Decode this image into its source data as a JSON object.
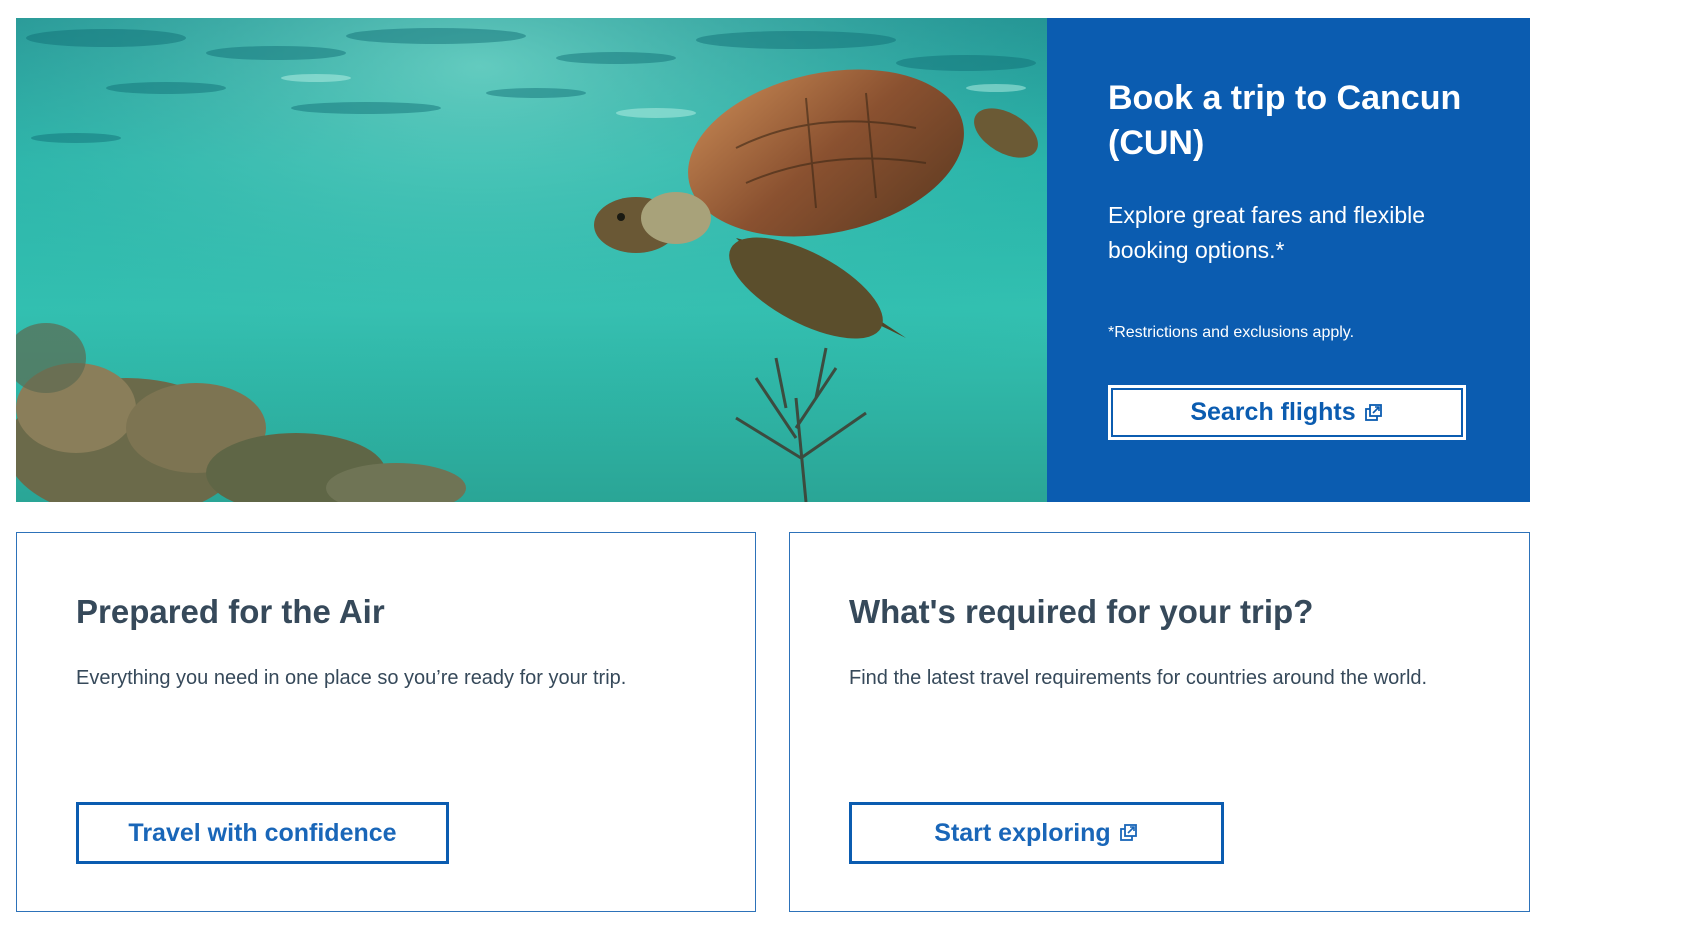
{
  "hero": {
    "image_alt": "Sea turtle swimming over coral reef",
    "title": "Book a trip to Cancun (CUN)",
    "subtitle": "Explore great fares and flexible booking options.*",
    "note": "*Restrictions and exclusions apply.",
    "button_label": "Search flights",
    "button_icon": "external-link-icon"
  },
  "cards": [
    {
      "title": "Prepared for the Air",
      "description": "Everything you need in one place so you’re ready for your trip.",
      "button_label": "Travel with confidence"
    },
    {
      "title": "What's required for your trip?",
      "description": "Find the latest travel requirements for countries around the world.",
      "button_label": "Start exploring",
      "button_icon": "external-link-icon"
    }
  ],
  "colors": {
    "brand_blue": "#0b5cb0",
    "card_border": "#2d72b9",
    "text_dark": "#36495a"
  }
}
